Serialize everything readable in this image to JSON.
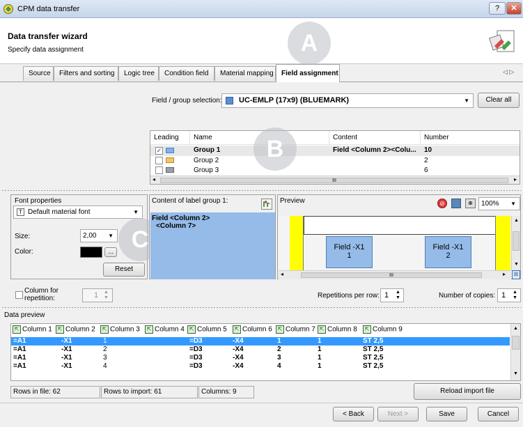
{
  "window": {
    "title": "CPM data transfer",
    "help_label": "?",
    "close_label": "✕"
  },
  "header": {
    "title": "Data transfer wizard",
    "subtitle": "Specify data assignment"
  },
  "markers": {
    "a": "A",
    "b": "B",
    "c": "C"
  },
  "tabs": [
    {
      "label": "Source"
    },
    {
      "label": "Filters and sorting"
    },
    {
      "label": "Logic tree"
    },
    {
      "label": "Condition field"
    },
    {
      "label": "Material mapping"
    },
    {
      "label": "Field assignment",
      "active": true
    }
  ],
  "tab_nav": "◁ ▷",
  "field_group": {
    "label": "Field / group selection:",
    "value": "UC-EMLP (17x9) (BLUEMARK)",
    "clear_label": "Clear all"
  },
  "groups_table": {
    "headers": [
      "Leading",
      "Name",
      "Content",
      "Number"
    ],
    "rows": [
      {
        "checked": true,
        "name": "Group 1",
        "content": "Field <Column 2><Colu...",
        "number": "10",
        "color": "#7fb2e5"
      },
      {
        "checked": false,
        "name": "Group 2",
        "content": "",
        "number": "2",
        "color": "#f2c46b"
      },
      {
        "checked": false,
        "name": "Group 3",
        "content": "",
        "number": "6",
        "color": "#9aa0a6"
      }
    ],
    "scroll_center": "III"
  },
  "font": {
    "title": "Font properties",
    "font_value": "Default material font",
    "size_label": "Size:",
    "size_value": "2,00",
    "color_label": "Color:",
    "color_value": "#000000",
    "more_label": "...",
    "reset_label": "Reset"
  },
  "content_group": {
    "label": "Content of label group 1:",
    "text_line1": "Field <Column 2>",
    "text_line2": "<Column 7>"
  },
  "preview": {
    "label": "Preview",
    "zoom": "100%",
    "cells": [
      {
        "line1": "Field -X1",
        "line2": "1"
      },
      {
        "line1": "Field -X1",
        "line2": "2"
      }
    ],
    "scroll_center": "III"
  },
  "repetition": {
    "col_label_line1": "Column for",
    "col_label_line2": "repetition:",
    "col_value": "1",
    "per_row_label": "Repetitions per row:",
    "per_row_value": "1",
    "copies_label": "Number of copies:",
    "copies_value": "1"
  },
  "data_preview": {
    "title": "Data preview",
    "columns": [
      "Column 1",
      "Column 2",
      "Column 3",
      "Column 4",
      "Column 5",
      "Column 6",
      "Column 7",
      "Column 8",
      "Column 9"
    ],
    "rows": [
      [
        "=A1",
        "-X1",
        "1",
        "",
        "=D3",
        "-X4",
        "1",
        "1",
        "ST 2,5"
      ],
      [
        "=A1",
        "-X1",
        "2",
        "",
        "=D3",
        "-X4",
        "2",
        "1",
        "ST 2,5"
      ],
      [
        "=A1",
        "-X1",
        "3",
        "",
        "=D3",
        "-X4",
        "3",
        "1",
        "ST 2,5"
      ],
      [
        "=A1",
        "-X1",
        "4",
        "",
        "=D3",
        "-X4",
        "4",
        "1",
        "ST 2,5"
      ]
    ]
  },
  "status": {
    "rows_in_file": "Rows in file: 62",
    "rows_to_import": "Rows to import: 61",
    "columns": "Columns: 9",
    "reload_label": "Reload import file"
  },
  "footer": {
    "back_label": "< Back",
    "next_label": "Next >",
    "save_label": "Save",
    "cancel_label": "Cancel"
  }
}
